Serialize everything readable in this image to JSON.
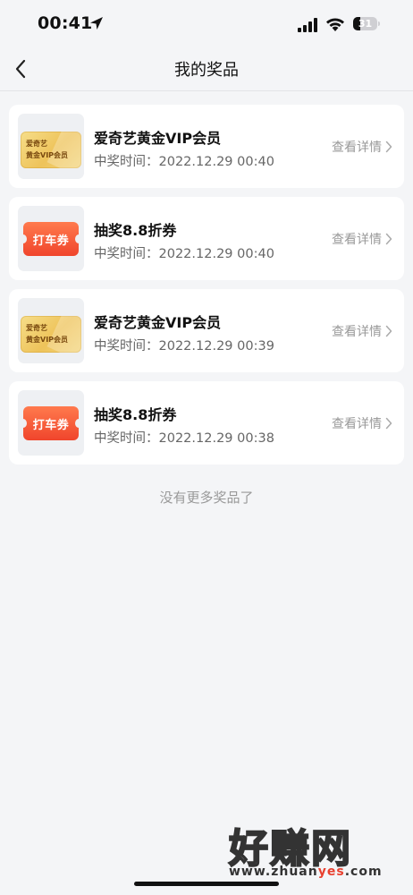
{
  "status_bar": {
    "time": "00:41",
    "battery_level": "31",
    "battery_fraction": 0.31,
    "icons": [
      "location-arrow-icon",
      "signal-icon",
      "wifi-icon",
      "battery-icon"
    ]
  },
  "nav": {
    "title": "我的奖品",
    "back_icon": "chevron-left-icon"
  },
  "prizes": [
    {
      "name": "爱奇艺黄金VIP会员",
      "time": "中奖时间：2022.12.29 00:40",
      "detail": "查看详情",
      "image": "vip-card",
      "image_text_1": "爱奇艺",
      "image_text_2": "黄金VIP会员"
    },
    {
      "name": "抽奖8.8折券",
      "time": "中奖时间：2022.12.29 00:40",
      "detail": "查看详情",
      "image": "ticket",
      "image_text": "打车券"
    },
    {
      "name": "爱奇艺黄金VIP会员",
      "time": "中奖时间：2022.12.29 00:39",
      "detail": "查看详情",
      "image": "vip-card",
      "image_text_1": "爱奇艺",
      "image_text_2": "黄金VIP会员"
    },
    {
      "name": "抽奖8.8折券",
      "time": "中奖时间：2022.12.29 00:38",
      "detail": "查看详情",
      "image": "ticket",
      "image_text": "打车券"
    }
  ],
  "footer_text": "没有更多奖品了",
  "watermark": {
    "title": "好赚网",
    "url_prefix": "www.zhuan",
    "url_highlight": "yes",
    "url_suffix": ".com",
    "highlight_color": "#e8402f"
  },
  "colors": {
    "background": "#f4f5f7",
    "card": "#ffffff",
    "ticket_red": "#f0452c",
    "vip_gold": "#eec35a"
  }
}
